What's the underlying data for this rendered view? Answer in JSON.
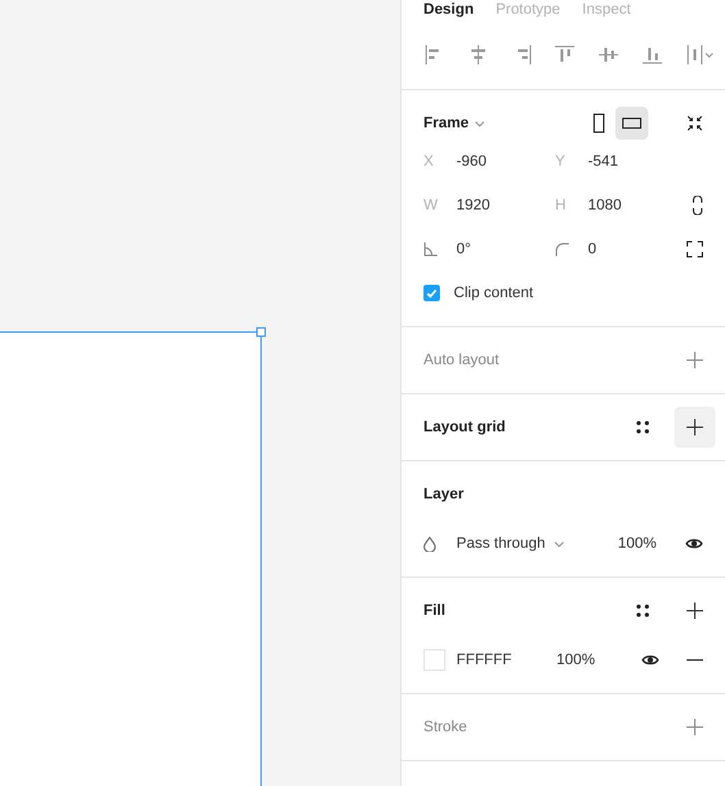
{
  "tabs": [
    {
      "label": "Design",
      "selected": true
    },
    {
      "label": "Prototype",
      "selected": false
    },
    {
      "label": "Inspect",
      "selected": false
    }
  ],
  "frame": {
    "title": "Frame",
    "orientation": [
      {
        "kind": "portrait",
        "selected": false
      },
      {
        "kind": "landscape",
        "selected": true
      }
    ],
    "fields": [
      {
        "label": "X",
        "value": "-960"
      },
      {
        "label": "Y",
        "value": "-541"
      },
      {
        "label": "W",
        "value": "1920"
      },
      {
        "label": "H",
        "value": "1080"
      }
    ],
    "rotation": "0°",
    "radius": "0",
    "clip_content": {
      "label": "Clip content",
      "checked": true
    }
  },
  "sections": [
    {
      "kind": "empty",
      "title": "Auto layout"
    },
    {
      "kind": "grid",
      "title": "Layout grid",
      "add_hovered": true
    },
    {
      "kind": "layer",
      "title": "Layer",
      "blend": "Pass through",
      "opacity": "100%"
    },
    {
      "kind": "fill",
      "title": "Fill",
      "color": "#ffffff",
      "hex": "FFFFFF",
      "opacity": "100%"
    },
    {
      "kind": "empty",
      "title": "Stroke"
    }
  ]
}
